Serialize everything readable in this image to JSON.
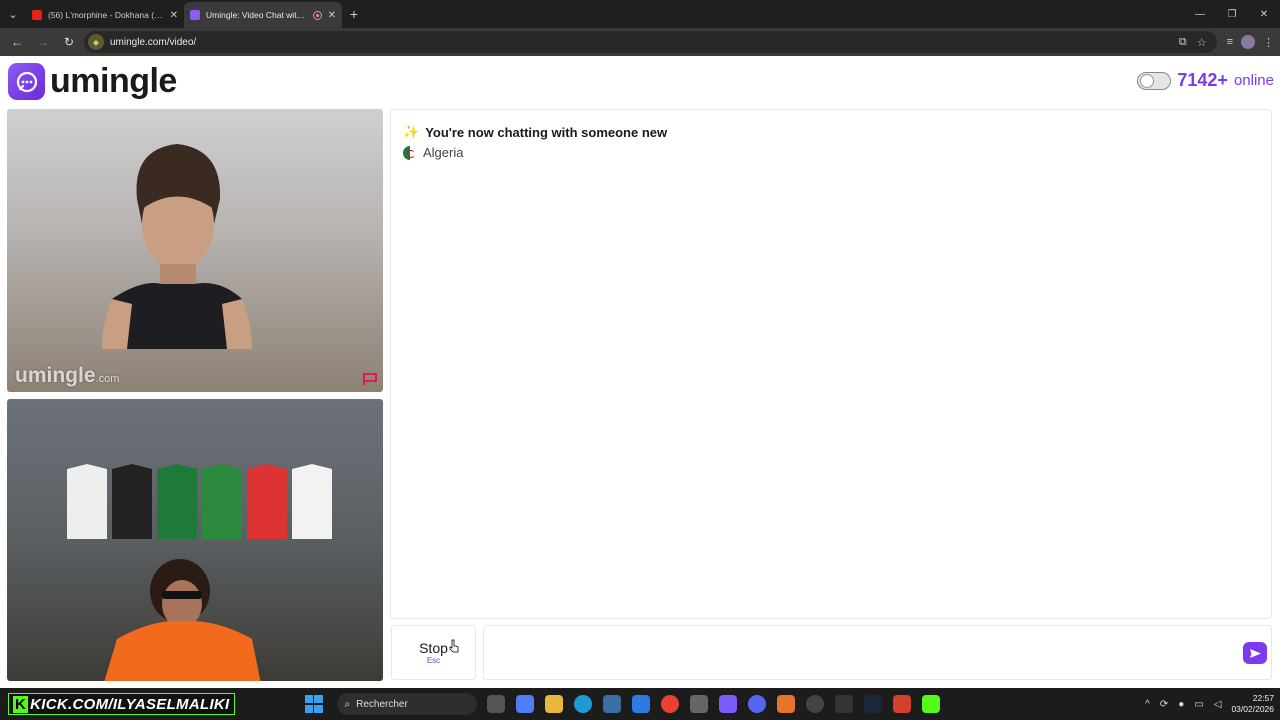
{
  "browser": {
    "tabs": [
      {
        "title": "(56) L'morphine - Dokhana (Offi",
        "active": false
      },
      {
        "title": "Umingle: Video Chat with St",
        "active": true
      }
    ],
    "url": "umingle.com/video/"
  },
  "site": {
    "logo_text": "umingle",
    "online_count": "7142+",
    "online_label": "online"
  },
  "remote_video": {
    "watermark": "umingle",
    "watermark_suffix": ".com"
  },
  "chat": {
    "status_message": "You're now chatting with someone new",
    "country": "Algeria"
  },
  "controls": {
    "stop_label": "Stop",
    "stop_key": "Esc"
  },
  "taskbar": {
    "kick_k": "K",
    "kick_text": "KICK.COM/ILYASELMALIKI",
    "search_label": "Rechercher",
    "time": "22:57",
    "date": "03/02/2026"
  },
  "colors": {
    "accent": "#7c3aed",
    "kick_green": "#53fc18"
  }
}
